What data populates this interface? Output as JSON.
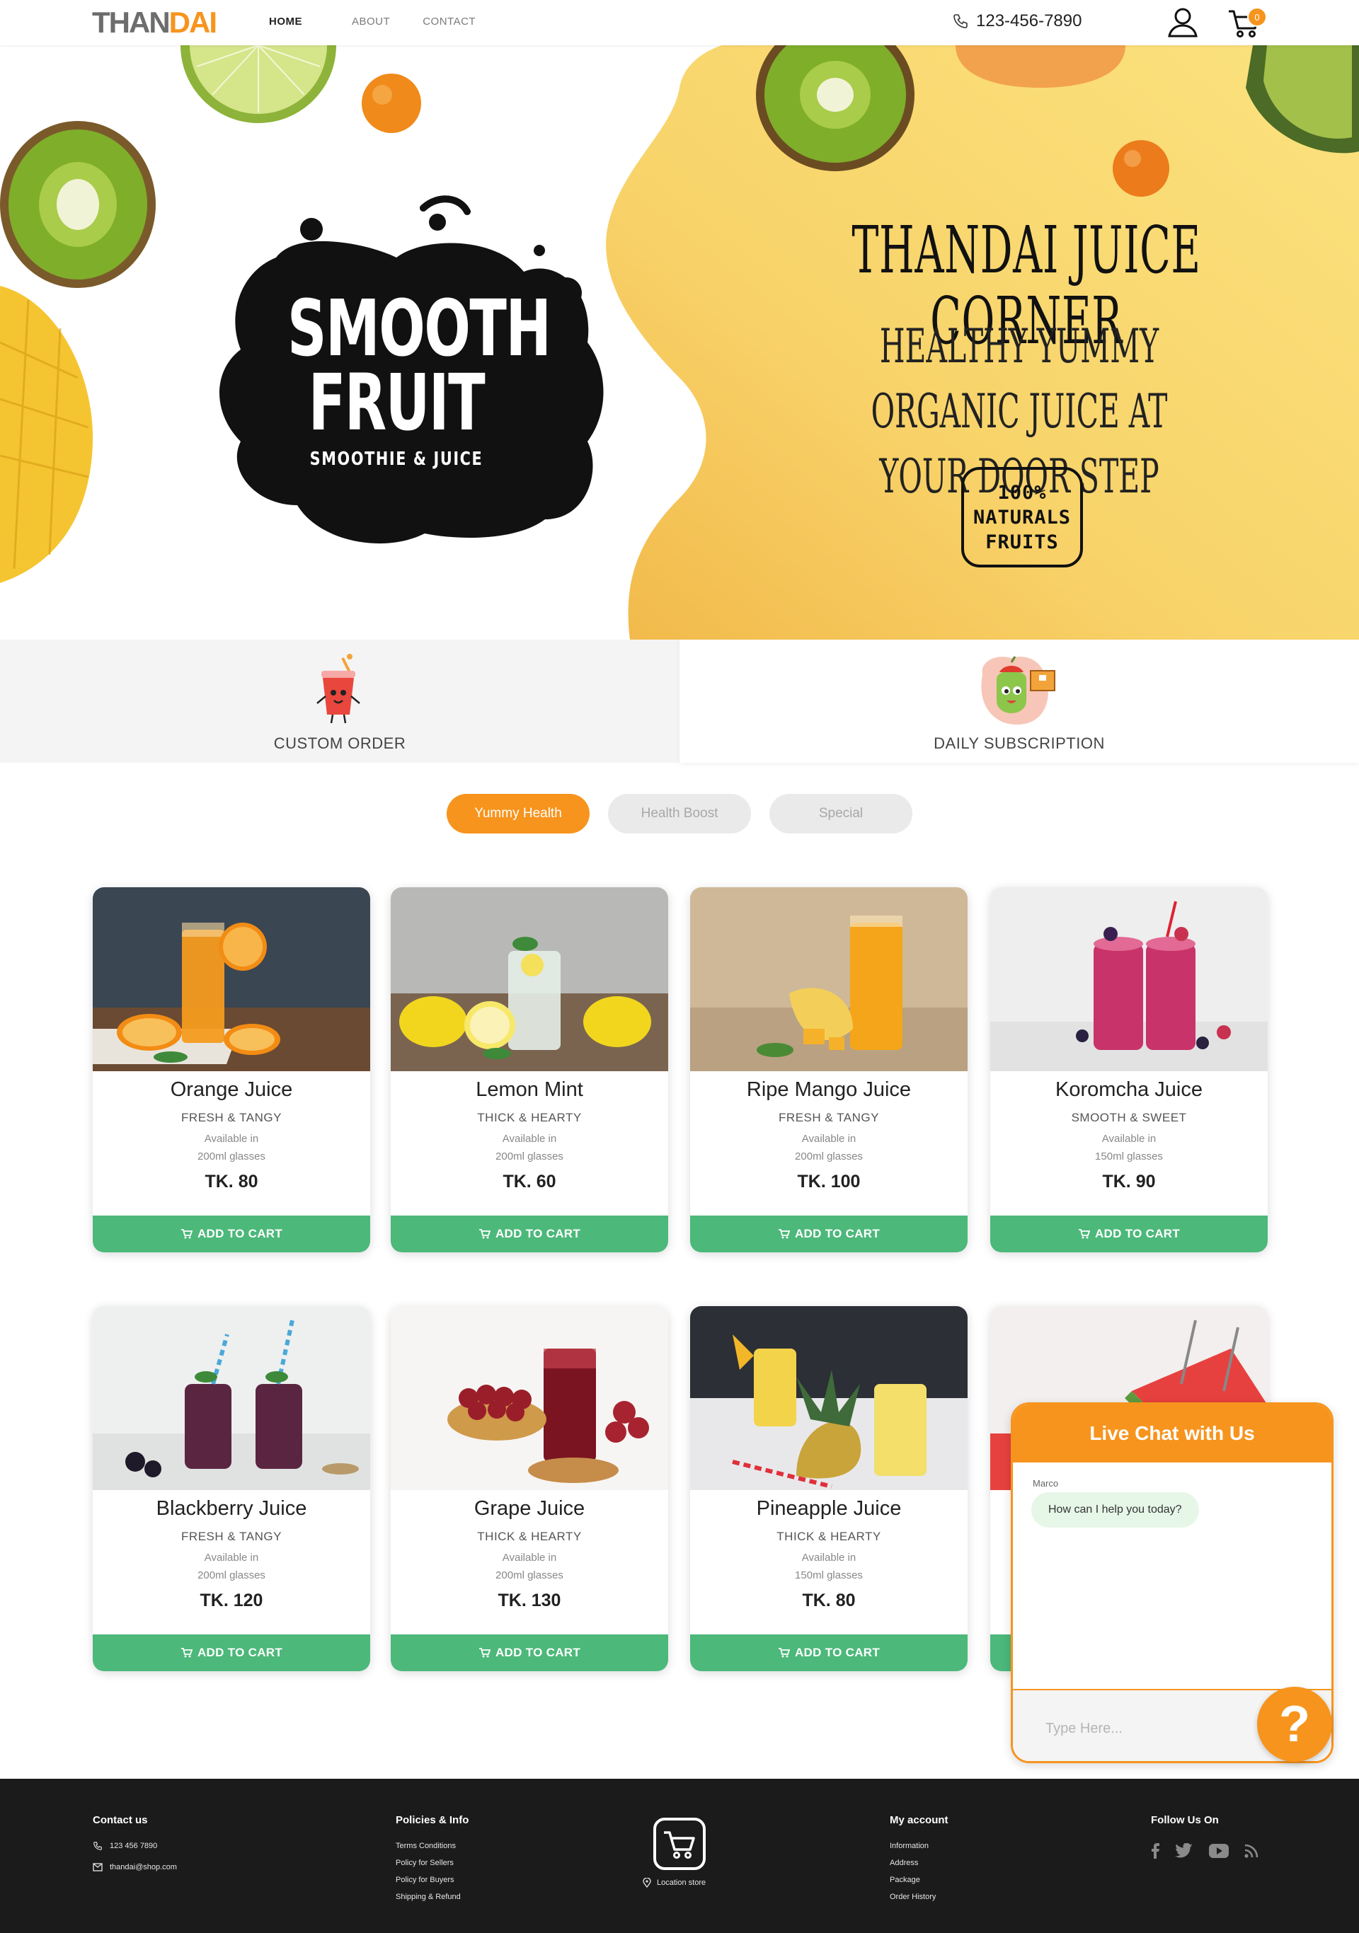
{
  "brand": {
    "logo_part1": "THAN",
    "logo_part2": "DAI"
  },
  "nav": {
    "home": "HOME",
    "about": "ABOUT",
    "contact": "CONTACT"
  },
  "header": {
    "phone": "123-456-7890",
    "cart_count": "0"
  },
  "hero": {
    "splash_line1": "SMOOTH",
    "splash_line2": "FRUIT",
    "splash_line3": "SMOOTHIE & JUICE",
    "title": "THANDAI JUICE CORNER",
    "subtitle": "HEALTHY YUMMY ORGANIC JUICE AT YOUR DOOR STEP",
    "badge_line1": "100%",
    "badge_line2": "NATURALS",
    "badge_line3": "FRUITS"
  },
  "services": [
    {
      "label": "CUSTOM ORDER",
      "icon": "juice-cup-icon"
    },
    {
      "label": "DAILY SUBSCRIPTION",
      "icon": "delivery-fruit-icon"
    }
  ],
  "tabs": [
    {
      "label": "Yummy Health",
      "active": true
    },
    {
      "label": "Health Boost",
      "active": false
    },
    {
      "label": "Special",
      "active": false
    }
  ],
  "products": [
    {
      "name": "Orange Juice",
      "tagline": "FRESH & TANGY",
      "avail": "Available in",
      "size": "200ml glasses",
      "price": "TK. 80",
      "button": "ADD TO CART"
    },
    {
      "name": "Lemon Mint",
      "tagline": "THICK & HEARTY",
      "avail": "Available in",
      "size": "200ml glasses",
      "price": "TK. 60",
      "button": "ADD TO CART"
    },
    {
      "name": "Ripe Mango Juice",
      "tagline": "FRESH & TANGY",
      "avail": "Available in",
      "size": "200ml glasses",
      "price": "TK. 100",
      "button": "ADD TO CART"
    },
    {
      "name": "Koromcha Juice",
      "tagline": "SMOOTH & SWEET",
      "avail": "Available in",
      "size": "150ml glasses",
      "price": "TK. 90",
      "button": "ADD TO CART"
    },
    {
      "name": "Blackberry Juice",
      "tagline": "FRESH & TANGY",
      "avail": "Available in",
      "size": "200ml glasses",
      "price": "TK. 120",
      "button": "ADD TO CART"
    },
    {
      "name": "Grape Juice",
      "tagline": "THICK & HEARTY",
      "avail": "Available in",
      "size": "200ml glasses",
      "price": "TK. 130",
      "button": "ADD TO CART"
    },
    {
      "name": "Pineapple Juice",
      "tagline": "THICK & HEARTY",
      "avail": "Available in",
      "size": "150ml glasses",
      "price": "TK. 80",
      "button": "ADD TO CART"
    }
  ],
  "chat": {
    "title": "Live Chat with Us",
    "sender": "Marco",
    "message": "How can I help you today?",
    "placeholder": "Type Here...",
    "help": "?"
  },
  "footer": {
    "contact_title": "Contact us",
    "contact_phone": "123 456 7890",
    "contact_email": "thandai@shop.com",
    "policies_title": "Policies & Info",
    "policies": [
      "Terms Conditions",
      "Policy for Sellers",
      "Policy for Buyers",
      "Shipping & Refund"
    ],
    "store_label": "Location store",
    "account_title": "My account",
    "account": [
      "Information",
      "Address",
      "Package",
      "Order History"
    ],
    "follow_title": "Follow Us On"
  },
  "colors": {
    "accent": "#f7941d",
    "green": "#4cb87a",
    "hero_yellow": "#f9d86a",
    "footer": "#1b1b1b"
  }
}
